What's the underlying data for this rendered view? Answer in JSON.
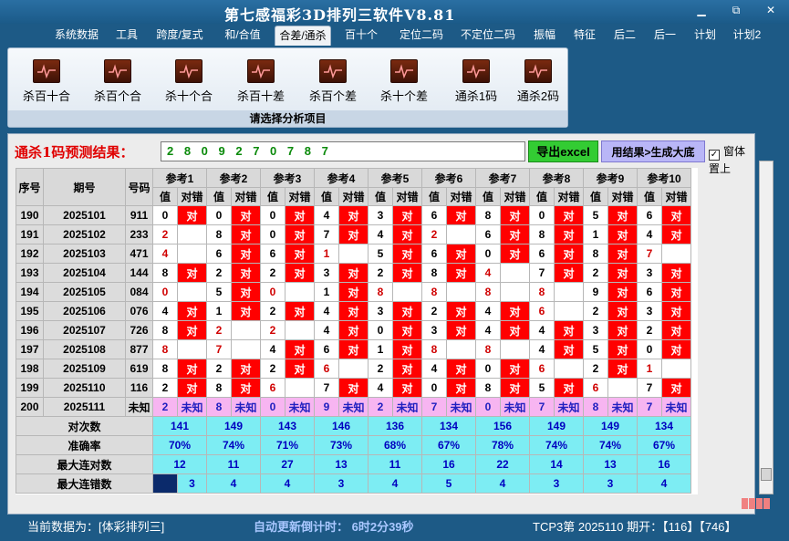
{
  "app": {
    "title": "第七感福彩3D排列三软件V8.81",
    "min": "▁",
    "restore": "⧉",
    "close": "✕"
  },
  "menu": [
    "系统数据",
    "工具",
    "跨度/复式",
    "和/合值",
    "合差/通杀",
    "百十个",
    "定位二码",
    "不定位二码",
    "振幅",
    "特征",
    "后二",
    "后一",
    "计划",
    "计划2"
  ],
  "menu_active": 4,
  "ribbon": {
    "tools": [
      "杀百十合",
      "杀百个合",
      "杀十个合",
      "杀百十差",
      "杀百个差",
      "杀十个差",
      "通杀1码",
      "通杀2码"
    ],
    "caption": "请选择分析项目"
  },
  "result": {
    "label": "通杀1码预测结果：",
    "value": "2 8 0 9 2 7 0 7 8 7",
    "excel_btn": "导出excel",
    "gen_btn": "用结果>生成大底",
    "topmost_label": "窗体置上"
  },
  "table": {
    "headers": {
      "seq": "序号",
      "issue": "期号",
      "code": "号码",
      "refs": [
        "参考1",
        "参考2",
        "参考3",
        "参考4",
        "参考5",
        "参考6",
        "参考7",
        "参考8",
        "参考9",
        "参考10"
      ],
      "val": "值",
      "hit": "对错"
    },
    "hit_text": "对",
    "rows": [
      {
        "seq": "190",
        "issue": "2025101",
        "code": "911",
        "v": [
          "0",
          "0",
          "0",
          "4",
          "3",
          "6",
          "8",
          "0",
          "5",
          "6"
        ],
        "h": [
          1,
          1,
          1,
          1,
          1,
          1,
          1,
          1,
          1,
          1
        ]
      },
      {
        "seq": "191",
        "issue": "2025102",
        "code": "233",
        "v": [
          "2",
          "8",
          "0",
          "7",
          "4",
          "2",
          "6",
          "8",
          "1",
          "4"
        ],
        "h": [
          0,
          1,
          1,
          1,
          1,
          0,
          1,
          1,
          1,
          1
        ]
      },
      {
        "seq": "192",
        "issue": "2025103",
        "code": "471",
        "v": [
          "4",
          "6",
          "6",
          "1",
          "5",
          "6",
          "0",
          "6",
          "8",
          "7"
        ],
        "h": [
          0,
          1,
          1,
          0,
          1,
          1,
          1,
          1,
          1,
          0
        ]
      },
      {
        "seq": "193",
        "issue": "2025104",
        "code": "144",
        "v": [
          "8",
          "2",
          "2",
          "3",
          "2",
          "8",
          "4",
          "7",
          "2",
          "3"
        ],
        "h": [
          1,
          1,
          1,
          1,
          1,
          1,
          0,
          1,
          1,
          1
        ]
      },
      {
        "seq": "194",
        "issue": "2025105",
        "code": "084",
        "v": [
          "0",
          "5",
          "0",
          "1",
          "8",
          "8",
          "8",
          "8",
          "9",
          "6"
        ],
        "h": [
          0,
          1,
          0,
          1,
          0,
          0,
          0,
          0,
          1,
          1
        ]
      },
      {
        "seq": "195",
        "issue": "2025106",
        "code": "076",
        "v": [
          "4",
          "1",
          "2",
          "4",
          "3",
          "2",
          "4",
          "6",
          "2",
          "3"
        ],
        "h": [
          1,
          1,
          1,
          1,
          1,
          1,
          1,
          0,
          1,
          1
        ]
      },
      {
        "seq": "196",
        "issue": "2025107",
        "code": "726",
        "v": [
          "8",
          "2",
          "2",
          "4",
          "0",
          "3",
          "4",
          "4",
          "3",
          "2"
        ],
        "h": [
          1,
          0,
          0,
          1,
          1,
          1,
          1,
          1,
          1,
          1
        ]
      },
      {
        "seq": "197",
        "issue": "2025108",
        "code": "877",
        "v": [
          "8",
          "7",
          "4",
          "6",
          "1",
          "8",
          "8",
          "4",
          "5",
          "0"
        ],
        "h": [
          0,
          0,
          1,
          1,
          1,
          0,
          0,
          1,
          1,
          1
        ]
      },
      {
        "seq": "198",
        "issue": "2025109",
        "code": "619",
        "v": [
          "8",
          "2",
          "2",
          "6",
          "2",
          "4",
          "0",
          "6",
          "2",
          "1"
        ],
        "h": [
          1,
          1,
          1,
          0,
          1,
          1,
          1,
          0,
          1,
          0
        ]
      },
      {
        "seq": "199",
        "issue": "2025110",
        "code": "116",
        "v": [
          "2",
          "8",
          "6",
          "7",
          "4",
          "0",
          "8",
          "5",
          "6",
          "7"
        ],
        "h": [
          1,
          1,
          0,
          1,
          1,
          1,
          1,
          1,
          0,
          1
        ]
      }
    ],
    "pred_row": {
      "seq": "200",
      "issue": "2025111",
      "code": "未知",
      "v": [
        "2",
        "8",
        "0",
        "9",
        "2",
        "7",
        "0",
        "7",
        "8",
        "7"
      ],
      "unknown": "未知"
    },
    "stats": [
      {
        "label": "对次数",
        "values": [
          "141",
          "149",
          "143",
          "146",
          "136",
          "134",
          "156",
          "149",
          "149",
          "134"
        ]
      },
      {
        "label": "准确率",
        "values": [
          "70%",
          "74%",
          "71%",
          "73%",
          "68%",
          "67%",
          "78%",
          "74%",
          "74%",
          "67%"
        ]
      },
      {
        "label": "最大连对数",
        "values": [
          "12",
          "11",
          "27",
          "13",
          "11",
          "16",
          "22",
          "14",
          "13",
          "16"
        ]
      },
      {
        "label": "最大连错数",
        "values": [
          "3",
          "4",
          "4",
          "3",
          "4",
          "5",
          "4",
          "3",
          "3",
          "4"
        ]
      }
    ]
  },
  "status": {
    "data": "当前数据为：[体彩排列三]",
    "countdown": "自动更新倒计时：  6时2分39秒",
    "info": "TCP3第 2025110 期开：【116】【746】"
  }
}
